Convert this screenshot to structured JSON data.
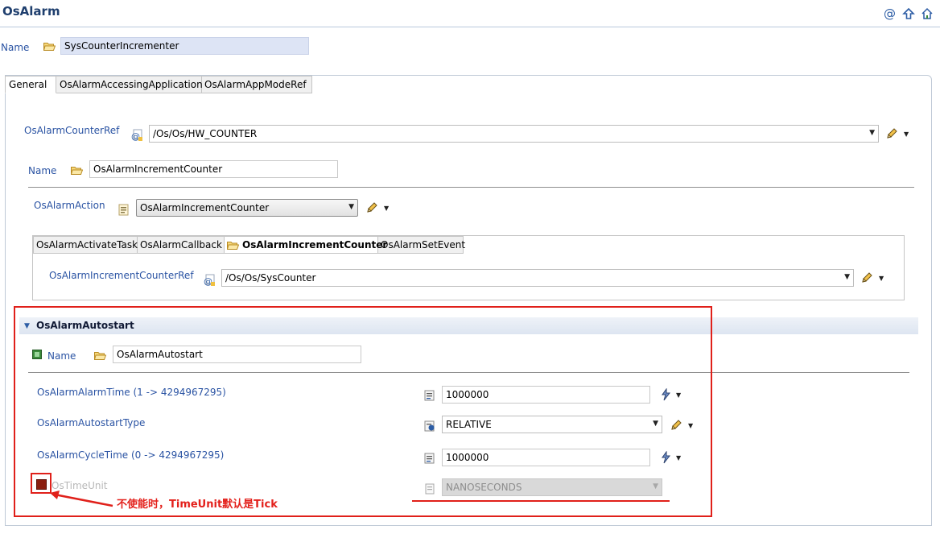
{
  "header": {
    "title": "OsAlarm",
    "icons": [
      "at-icon",
      "up-arrow-icon",
      "home-icon"
    ]
  },
  "name_field": {
    "label": "Name",
    "value": "SysCounterIncrementer"
  },
  "main_tabs": [
    {
      "label": "General",
      "active": true
    },
    {
      "label": "OsAlarmAccessingApplication",
      "active": false
    },
    {
      "label": "OsAlarmAppModeRef",
      "active": false
    }
  ],
  "general": {
    "counter_ref": {
      "label": "OsAlarmCounterRef",
      "value": "/Os/Os/HW_COUNTER"
    },
    "action_name": {
      "label": "Name",
      "value": "OsAlarmIncrementCounter"
    },
    "action": {
      "label": "OsAlarmAction",
      "selected": "OsAlarmIncrementCounter"
    },
    "action_tabs": [
      {
        "label": "OsAlarmActivateTask"
      },
      {
        "label": "OsAlarmCallback"
      },
      {
        "label": "OsAlarmIncrementCounter"
      },
      {
        "label": "OsAlarmSetEvent"
      }
    ],
    "increment_counter_ref": {
      "label": "OsAlarmIncrementCounterRef",
      "value": "/Os/Os/SysCounter"
    }
  },
  "autostart": {
    "section_title": "OsAlarmAutostart",
    "name": {
      "label": "Name",
      "value": "OsAlarmAutostart"
    },
    "alarm_time": {
      "label": "OsAlarmAlarmTime (1 -> 4294967295)",
      "value": "1000000"
    },
    "autostart_type": {
      "label": "OsAlarmAutostartType",
      "selected": "RELATIVE"
    },
    "cycle_time": {
      "label": "OsAlarmCycleTime (0 -> 4294967295)",
      "value": "1000000"
    },
    "time_unit": {
      "label": "OsTimeUnit",
      "selected": "NANOSECONDS",
      "enabled": false
    }
  },
  "annotation": {
    "text": "不使能时，TimeUnit默认是Tick",
    "color": "#e0201a"
  },
  "colors": {
    "label": "#2a53a3",
    "title": "#1f3f6e",
    "highlight": "#e0201a"
  }
}
